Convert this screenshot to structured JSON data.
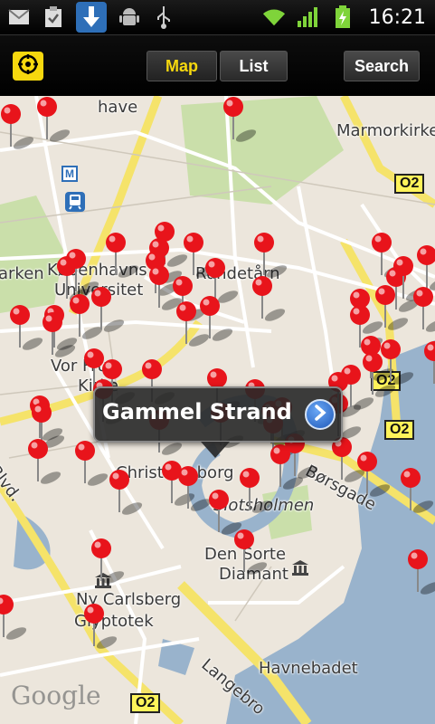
{
  "status_bar": {
    "time": "16:21",
    "icons": [
      "gmail-icon",
      "clipboard-icon",
      "download-icon",
      "android-debug-icon",
      "usb-icon",
      "wifi-icon",
      "signal-icon",
      "battery-charging-icon"
    ]
  },
  "toolbar": {
    "locate_icon": "crosshair-locate-icon",
    "map_label": "Map",
    "list_label": "List",
    "search_label": "Search",
    "active_tab": "Map",
    "accent": "#f6d80e"
  },
  "map": {
    "labels": {
      "have": "have",
      "marmorkirke": "Marmorkirke",
      "arken": "arken",
      "kobenhavns": "Københavns",
      "universitet": "Universitet",
      "rundetarn": "Rundetårn",
      "vor_frue": "Vor Frue",
      "kirke": "Kirke",
      "christiansborg": "Christiansborg",
      "slotsholmen": "Slotsholmen",
      "borsgade": "Børsgade",
      "den_sorte": "Den Sorte",
      "diamant": "Diamant",
      "ny_carlsberg": "Ny Carlsberg",
      "glyptotek": "Glyptotek",
      "havnebadet": "Havnebadet",
      "langebro": "Langebro",
      "blvd": "Blvd.",
      "o2": "O2",
      "metro": "M"
    },
    "google_logo": "Google",
    "marker_color": "#e8141b",
    "water_color": "#99b3cc",
    "park_color": "#cadfaa",
    "road_color": "#fff79e"
  },
  "callout": {
    "title": "Gammel Strand",
    "details_icon": "chevron-right-icon"
  }
}
